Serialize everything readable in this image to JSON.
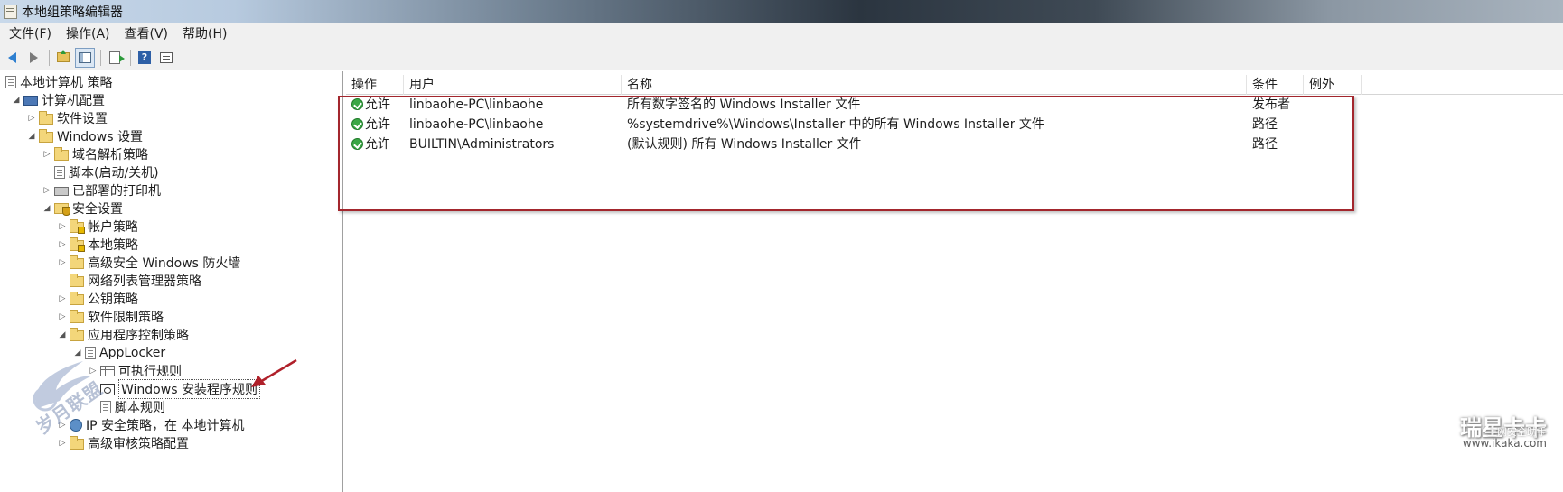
{
  "window": {
    "title": "本地组策略编辑器"
  },
  "menu": [
    {
      "label": "文件(F)"
    },
    {
      "label": "操作(A)"
    },
    {
      "label": "查看(V)"
    },
    {
      "label": "帮助(H)"
    }
  ],
  "toolbar": {
    "icons": [
      "back-icon",
      "forward-icon",
      "up-folder-icon",
      "show-hide-tree-icon",
      "export-list-icon",
      "help-icon",
      "properties-icon"
    ]
  },
  "tree": {
    "items": [
      {
        "label": "本地计算机 策略",
        "icon": "policy-doc-icon"
      },
      {
        "label": "计算机配置",
        "icon": "computer-icon"
      },
      {
        "label": "软件设置",
        "icon": "folder-icon"
      },
      {
        "label": "Windows 设置",
        "icon": "folder-icon"
      },
      {
        "label": "域名解析策略",
        "icon": "folder-icon"
      },
      {
        "label": "脚本(启动/关机)",
        "icon": "script-doc-icon"
      },
      {
        "label": "已部署的打印机",
        "icon": "printer-icon"
      },
      {
        "label": "安全设置",
        "icon": "security-settings-icon"
      },
      {
        "label": "帐户策略",
        "icon": "locked-folder-icon"
      },
      {
        "label": "本地策略",
        "icon": "locked-folder-icon"
      },
      {
        "label": "高级安全 Windows 防火墙",
        "icon": "folder-icon"
      },
      {
        "label": "网络列表管理器策略",
        "icon": "folder-icon"
      },
      {
        "label": "公钥策略",
        "icon": "folder-icon"
      },
      {
        "label": "软件限制策略",
        "icon": "folder-icon"
      },
      {
        "label": "应用程序控制策略",
        "icon": "folder-icon"
      },
      {
        "label": "AppLocker",
        "icon": "applocker-icon"
      },
      {
        "label": "可执行规则",
        "icon": "rules-icon"
      },
      {
        "label": "Windows 安装程序规则",
        "icon": "installer-rules-icon"
      },
      {
        "label": "脚本规则",
        "icon": "script-rules-icon"
      },
      {
        "label": "IP 安全策略，在 本地计算机",
        "icon": "ip-security-icon"
      },
      {
        "label": "高级审核策略配置",
        "icon": "folder-icon"
      }
    ]
  },
  "list": {
    "columns": [
      "操作",
      "用户",
      "名称",
      "条件",
      "例外"
    ],
    "rows": [
      {
        "action": "允许",
        "user": "linbaohe-PC\\linbaohe",
        "name": "所有数字签名的 Windows Installer 文件",
        "condition": "发布者",
        "exception": ""
      },
      {
        "action": "允许",
        "user": "linbaohe-PC\\linbaohe",
        "name": "%systemdrive%\\Windows\\Installer 中的所有 Windows Installer 文件",
        "condition": "路径",
        "exception": ""
      },
      {
        "action": "允许",
        "user": "BUILTIN\\Administrators",
        "name": "(默认规则) 所有 Windows Installer 文件",
        "condition": "路径",
        "exception": ""
      }
    ]
  },
  "colors": {
    "highlight_box": "#a3262d",
    "annotation_arrow": "#b0202a",
    "allow_icon": "#3aa645"
  },
  "watermarks": {
    "left": "岁月联盟",
    "right_main": "瑞星卡卡",
    "right_sub": "上网安全助手",
    "right_url": "www.ikaka.com"
  }
}
